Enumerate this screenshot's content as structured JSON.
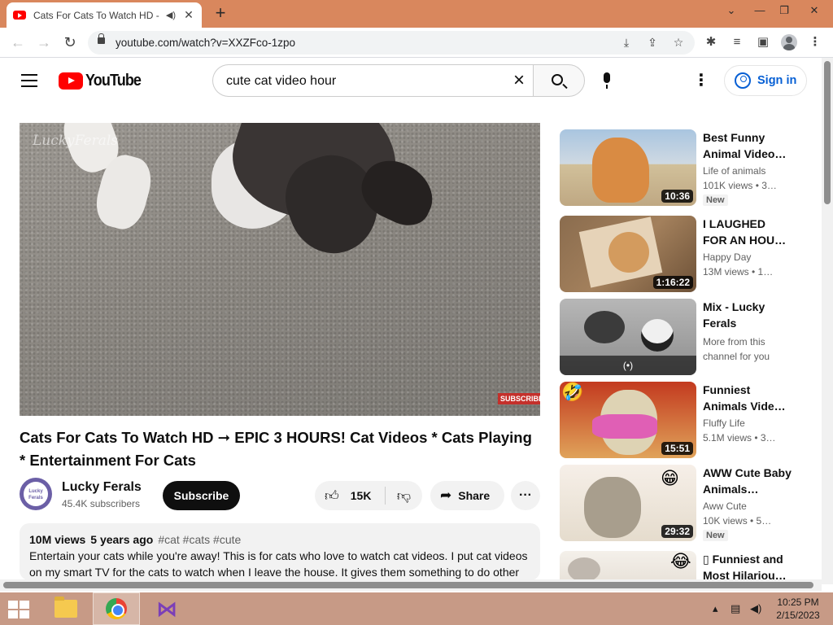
{
  "browser": {
    "tab_title": "Cats For Cats To Watch HD -",
    "new_tab_icon": "plus",
    "url": "youtube.com/watch?v=XXZFco-1zpo"
  },
  "youtube": {
    "logo_text": "YouTube",
    "search_value": "cute cat video hour",
    "signin_label": "Sign in"
  },
  "video": {
    "watermark": "LuckyFerals",
    "subscribe_overlay": "SUBSCRIBE",
    "title": "Cats For Cats To Watch HD ➞ EPIC 3 HOURS! Cat Videos * Cats Playing * Entertainment For Cats",
    "channel_name": "Lucky Ferals",
    "channel_avatar_text": "Lucky Ferals",
    "subscribers": "45.4K subscribers",
    "subscribe_label": "Subscribe",
    "like_count": "15K",
    "share_label": "Share",
    "views": "10M views",
    "age": "5 years ago",
    "tags": "#cat #cats #cute",
    "description": "Entertain your cats while you're away! This is for cats who love to watch cat videos. I put cat videos on my smart TV for the cats to watch when I leave the house. It gives them something to do other"
  },
  "recommendations": [
    {
      "title": "Best Funny Animal Video…",
      "channel": "Life of animals",
      "views": "101K views  • 3…",
      "duration": "10:36",
      "badge": "New"
    },
    {
      "title": "I LAUGHED FOR AN HOUR🙀…",
      "channel": "Happy Day",
      "views": "13M views  • 1…",
      "duration": "1:16:22",
      "badge": ""
    },
    {
      "title": "Mix - Lucky Ferals",
      "channel": "More from this channel for you",
      "views": "",
      "duration": "",
      "badge": "",
      "live_icon": "(•)"
    },
    {
      "title": "Funniest Animals Vide…",
      "channel": "Fluffy Life",
      "views": "5.1M views  • 3…",
      "duration": "15:51",
      "badge": ""
    },
    {
      "title": "AWW Cute Baby Animals…",
      "channel": "Aww Cute",
      "views": "10K views  • 5…",
      "duration": "29:32",
      "badge": "New"
    },
    {
      "title": "▯ Funniest and Most Hilariou…",
      "channel": "",
      "views": "",
      "duration": "",
      "badge": ""
    }
  ],
  "taskbar": {
    "time": "10:25 PM",
    "date": "2/15/2023"
  }
}
